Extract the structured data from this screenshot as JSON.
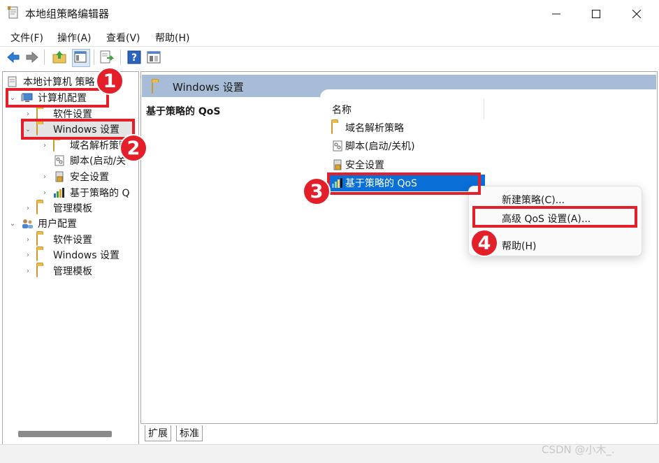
{
  "window": {
    "title": "本地组策略编辑器",
    "controls": {
      "minimize": "—",
      "maximize": "☐",
      "close": "✕"
    }
  },
  "menu": [
    "文件(F)",
    "操作(A)",
    "查看(V)",
    "帮助(H)"
  ],
  "toolbar": {
    "icons": [
      "back-icon",
      "forward-icon",
      "up-folder-icon",
      "show-hide-tree-icon",
      "export-list-icon",
      "help-icon",
      "properties-icon"
    ]
  },
  "tree": {
    "root": "本地计算机 策略",
    "computer_config": "计算机配置",
    "computer_children": {
      "software": "软件设置",
      "windows": "Windows 设置",
      "windows_children": [
        "域名解析策略",
        "脚本(启动/关",
        "安全设置",
        "基于策略的 Q"
      ],
      "admin_templates": "管理模板"
    },
    "user_config": "用户配置",
    "user_children": [
      "软件设置",
      "Windows 设置",
      "管理模板"
    ]
  },
  "right_pane": {
    "header": "Windows 设置",
    "description_title": "基于策略的 QoS",
    "column_name": "名称",
    "items": [
      "域名解析策略",
      "脚本(启动/关机)",
      "安全设置",
      "基于策略的 QoS"
    ],
    "selected_index": 3
  },
  "tabs": [
    "扩展",
    "标准"
  ],
  "context_menu": [
    "新建策略(C)...",
    "高级 QoS 设置(A)...",
    "帮助(H)"
  ],
  "annotations": [
    "1",
    "2",
    "3",
    "4"
  ],
  "watermark": "CSDN @小木_.",
  "colors": {
    "accent_red": "#e3202a",
    "selection_blue": "#0a6fd6",
    "header_blue": "#a7bcd6"
  }
}
